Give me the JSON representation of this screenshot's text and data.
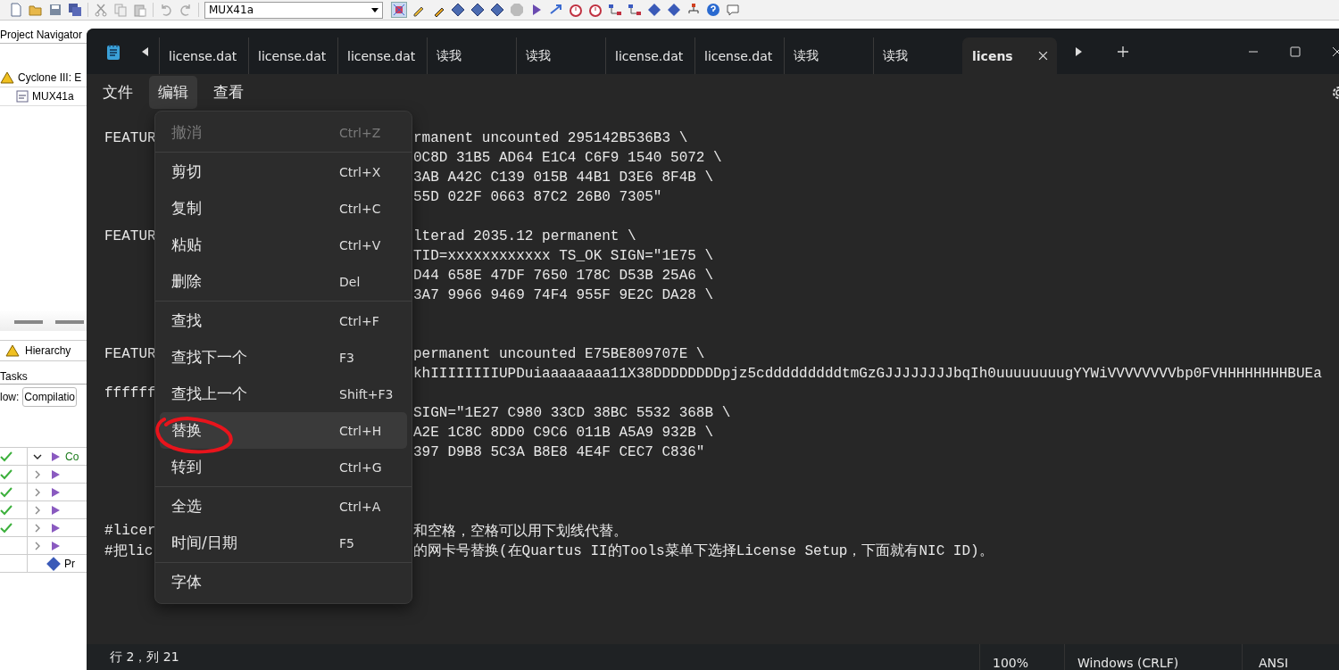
{
  "quartus": {
    "toolbar": {
      "dropdown": "MUX41a"
    },
    "navigator": {
      "title": "Project Navigator",
      "tree": [
        {
          "label": "Cyclone III: E",
          "children": [
            {
              "label": "MUX41a"
            }
          ]
        }
      ]
    },
    "hierarchy_tab": "Hierarchy",
    "tasks": {
      "title": "Tasks",
      "flow_label": "low:",
      "flow_value": "Compilatio",
      "rows": [
        {
          "label": "Co",
          "done": true,
          "expanded": true
        },
        {
          "done": true,
          "expanded": false
        },
        {
          "done": true,
          "expanded": false
        },
        {
          "done": true,
          "expanded": false
        },
        {
          "done": true,
          "expanded": false
        },
        {
          "done": false,
          "expanded": false
        },
        {
          "label": "Pr",
          "kind": "program"
        }
      ]
    }
  },
  "notepad": {
    "tabs": [
      {
        "label": "license.dat",
        "selected": false
      },
      {
        "label": "license.dat",
        "selected": false
      },
      {
        "label": "license.dat",
        "selected": false
      },
      {
        "label": "读我",
        "selected": false
      },
      {
        "label": "读我",
        "selected": false
      },
      {
        "label": "license.dat",
        "selected": false
      },
      {
        "label": "license.dat",
        "selected": false
      },
      {
        "label": "读我",
        "selected": false
      },
      {
        "label": "读我",
        "selected": false
      },
      {
        "label": "licens",
        "selected": true
      }
    ],
    "menubar": [
      {
        "label": "文件",
        "selected": false
      },
      {
        "label": "编辑",
        "selected": true
      },
      {
        "label": "查看",
        "selected": false
      }
    ],
    "paragraphs": [
      [
        {
          "left": "FEATUR",
          "right": "rmanent uncounted 295142B536B3 \\"
        },
        {
          "right": "0C8D 31B5 AD64 E1C4 C6F9 1540 5072 \\"
        },
        {
          "right": "3AB A42C C139 015B 44B1 D3E6 8F4B \\"
        },
        {
          "right": "55D 022F 0663 87C2 26B0 7305\""
        }
      ],
      [
        {
          "left": "FEATUR",
          "right": "lterad 2035.12 permanent \\"
        },
        {
          "right": "TID=xxxxxxxxxxxx TS_OK SIGN=\"1E75 \\"
        },
        {
          "right": "D44 658E 47DF 7650 178C D53B 25A6 \\"
        },
        {
          "right": "3A7 9966 9469 74F4 955F 9E2C DA28 \\"
        }
      ],
      [
        {
          "left": "FEATUR",
          "right": "permanent uncounted E75BE809707E \\"
        },
        {
          "right": "khIIIIIIIIUPDuiaaaaaaaa11X38DDDDDDDDpjz5cdddddddddtmGzGJJJJJJJJbqIh0uuuuuuuugYYWiVVVVVVVVbp0FVHHHHHHHHBUEa"
        },
        {
          "left": "ffffff"
        },
        {
          "right": "SIGN=\"1E27 C980 33CD 38BC 5532 368B \\"
        },
        {
          "right": "A2E 1C8C 8DD0 C9C6 011B A5A9 932B \\"
        },
        {
          "right": "397 D9B8 5C3A B8E8 4E4F CEC7 C836\""
        }
      ],
      [
        {
          "left": "#licer",
          "right": "和空格，空格可以用下划线代替。"
        },
        {
          "left": "#把lic",
          "right": "的网卡号替换(在Quartus II的Tools菜单下选择License Setup，下面就有NIC ID)。"
        }
      ]
    ],
    "edit_menu": [
      [
        {
          "label": "撤消",
          "shortcut": "Ctrl+Z",
          "disabled": true,
          "selected": false
        }
      ],
      [
        {
          "label": "剪切",
          "shortcut": "Ctrl+X",
          "disabled": false,
          "selected": false
        },
        {
          "label": "复制",
          "shortcut": "Ctrl+C",
          "disabled": false,
          "selected": false
        },
        {
          "label": "粘贴",
          "shortcut": "Ctrl+V",
          "disabled": false,
          "selected": false
        },
        {
          "label": "删除",
          "shortcut": "Del",
          "disabled": false,
          "selected": false
        }
      ],
      [
        {
          "label": "查找",
          "shortcut": "Ctrl+F",
          "disabled": false,
          "selected": false
        },
        {
          "label": "查找下一个",
          "shortcut": "F3",
          "disabled": false,
          "selected": false
        },
        {
          "label": "查找上一个",
          "shortcut": "Shift+F3",
          "disabled": false,
          "selected": false
        },
        {
          "label": "替换",
          "shortcut": "Ctrl+H",
          "disabled": false,
          "selected": true
        },
        {
          "label": "转到",
          "shortcut": "Ctrl+G",
          "disabled": false,
          "selected": false
        }
      ],
      [
        {
          "label": "全选",
          "shortcut": "Ctrl+A",
          "disabled": false,
          "selected": false
        },
        {
          "label": "时间/日期",
          "shortcut": "F5",
          "disabled": false,
          "selected": false
        }
      ],
      [
        {
          "label": "字体",
          "disabled": false,
          "selected": false
        }
      ]
    ],
    "status_bar": {
      "position": "行 2，列 21",
      "zoom": "100%",
      "line_ending": "Windows (CRLF)",
      "encoding": "ANSI"
    }
  }
}
